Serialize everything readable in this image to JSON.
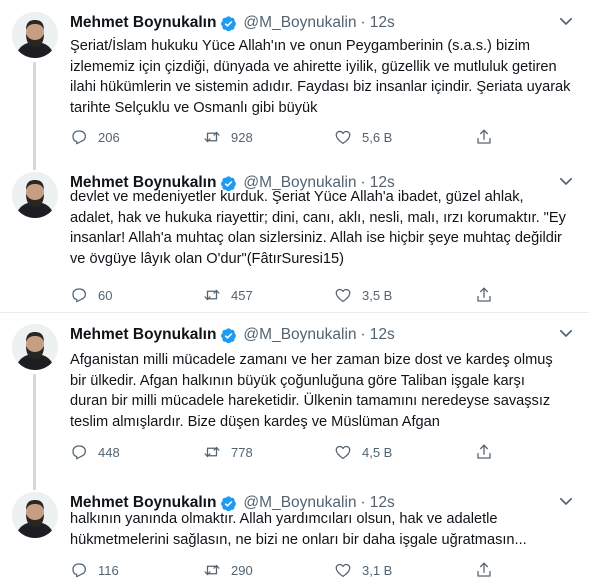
{
  "colors": {
    "verified": "#1d9bf0",
    "text": "#0f1419",
    "secondary": "#536471",
    "divider": "#e6ecf0",
    "thread_line": "#cfd9de"
  },
  "icons": {
    "verified": "verified-badge-icon",
    "more": "chevron-down-icon",
    "reply": "reply-icon",
    "retweet": "retweet-icon",
    "like": "heart-icon",
    "share": "share-icon"
  },
  "tweets": [
    {
      "name": "Mehmet Boynukalın",
      "handle": "@M_Boynukalin",
      "separator": "·",
      "time": "12s",
      "lines": [
        "Şeriat/İslam hukuku Yüce Allah'ın ve onun Peygamberinin (s.a.s.) bizim",
        "izlememiz için çizdiği, dünyada ve ahirette iyilik, güzellik ve mutluluk getiren",
        "ilahi hükümlerin ve sistemin adıdır. Faydası biz insanlar içindir. Şeriata uyarak",
        "tarihte Selçuklu ve Osmanlı gibi büyük"
      ],
      "replies": "206",
      "retweets": "928",
      "likes": "5,6 B"
    },
    {
      "name": "Mehmet Boynukalın",
      "handle": "@M_Boynukalin",
      "separator": "·",
      "time": "12s",
      "lines": [
        "devlet ve medeniyetler kurduk. Şeriat Yüce Allah'a ibadet, güzel ahlak,",
        "adalet, hak ve hukuka riayettir; dini, canı, aklı, nesli, malı, ırzı korumaktır. \"Ey",
        "insanlar! Allah'a muhtaç olan sizlersiniz. Allah ise hiçbir şeye muhtaç değildir",
        "ve övgüye lâyık olan O'dur\"(FâtırSuresi15)"
      ],
      "replies": "60",
      "retweets": "457",
      "likes": "3,5 B"
    },
    {
      "name": "Mehmet Boynukalın",
      "handle": "@M_Boynukalin",
      "separator": "·",
      "time": "12s",
      "lines": [
        "Afganistan milli mücadele zamanı ve her zaman bize dost ve kardeş olmuş",
        "bir ülkedir. Afgan halkının büyük çoğunluğuna göre Taliban işgale karşı",
        "duran bir milli mücadele hareketidir. Ülkenin tamamını neredeyse savaşsız",
        "teslim almışlardır. Bize düşen kardeş ve Müslüman Afgan"
      ],
      "replies": "448",
      "retweets": "778",
      "likes": "4,5 B"
    },
    {
      "name": "Mehmet Boynukalın",
      "handle": "@M_Boynukalin",
      "separator": "·",
      "time": "12s",
      "lines": [
        "halkının yanında  olmaktır. Allah yardımcıları olsun, hak ve adaletle",
        "hükmetmelerini sağlasın, ne bizi ne onları bir daha işgale uğratmasın..."
      ],
      "replies": "116",
      "retweets": "290",
      "likes": "3,1 B"
    }
  ]
}
